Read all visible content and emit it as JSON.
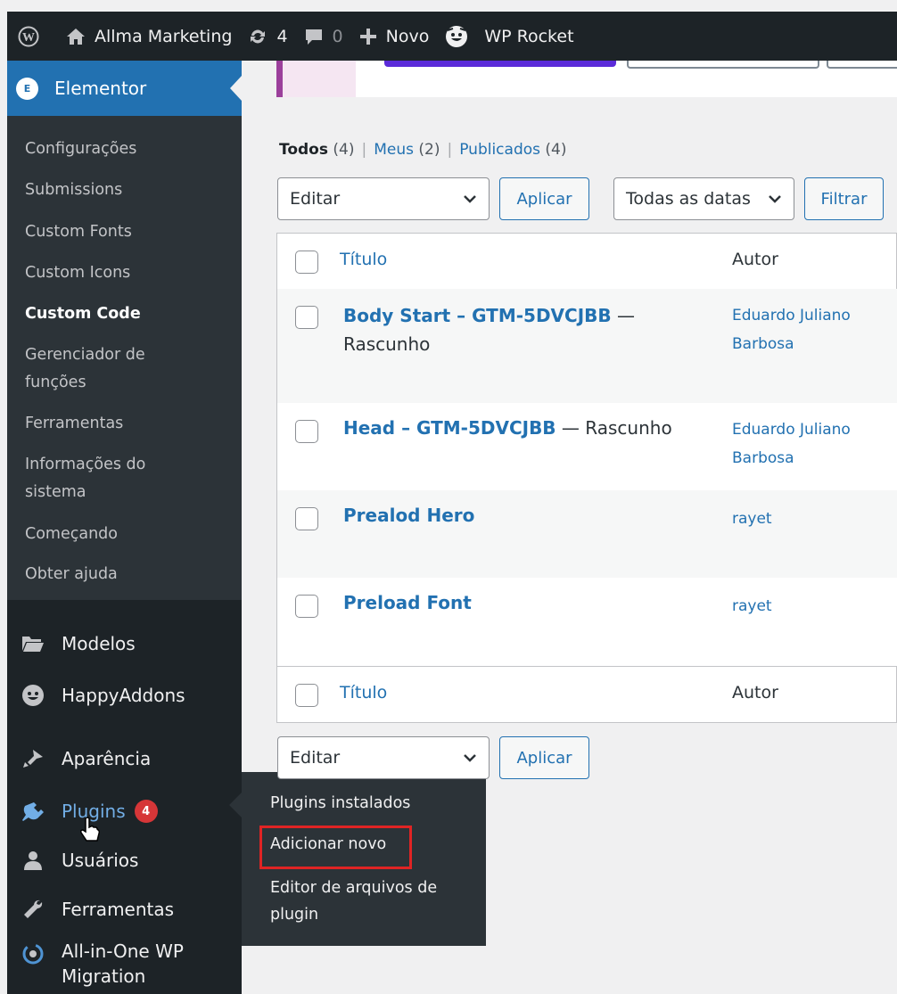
{
  "admin_bar": {
    "site_name": "Allma Marketing",
    "updates_count": "4",
    "comments_count": "0",
    "new_label": "Novo",
    "wp_rocket_label": "WP Rocket"
  },
  "sidebar": {
    "elementor_label": "Elementor",
    "elementor_badge": "E",
    "submenu": [
      "Configurações",
      "Submissions",
      "Custom Fonts",
      "Custom Icons",
      "Custom Code",
      "Gerenciador de funções",
      "Ferramentas",
      "Informações do sistema",
      "Começando",
      "Obter ajuda"
    ],
    "menu": {
      "modelos": "Modelos",
      "happyaddons": "HappyAddons",
      "aparencia": "Aparência",
      "plugins": "Plugins",
      "plugins_badge": "4",
      "usuarios": "Usuários",
      "ferramentas": "Ferramentas",
      "allinone": "All-in-One WP Migration"
    }
  },
  "flyout": {
    "items": [
      "Plugins instalados",
      "Adicionar novo",
      "Editor de arquivos de plugin"
    ]
  },
  "views": {
    "all_label": "Todos",
    "all_count": "(4)",
    "mine_label": "Meus",
    "mine_count": "(2)",
    "published_label": "Publicados",
    "published_count": "(4)"
  },
  "filters": {
    "bulk_action": "Editar",
    "apply": "Aplicar",
    "dates": "Todas as datas",
    "filter": "Filtrar"
  },
  "table": {
    "col_title": "Título",
    "col_author": "Autor",
    "rows": [
      {
        "title": "Body Start – GTM-5DVCJBB",
        "state_dash": " — ",
        "state": "Rascunho",
        "author": "Eduardo Juliano Barbosa"
      },
      {
        "title": "Head – GTM-5DVCJBB",
        "state_dash": " — ",
        "state": "Rascunho",
        "author": "Eduardo Juliano Barbosa"
      },
      {
        "title": "Prealod Hero",
        "state_dash": "",
        "state": "",
        "author": "rayet"
      },
      {
        "title": "Preload Font",
        "state_dash": "",
        "state": "",
        "author": "rayet"
      }
    ]
  },
  "bottom_filters": {
    "bulk_action": "Editar",
    "apply": "Aplicar"
  },
  "colors": {
    "admin_bar_bg": "#1d2327",
    "accent": "#2271b1",
    "badge": "#d63638",
    "highlight_box": "#e02424"
  }
}
